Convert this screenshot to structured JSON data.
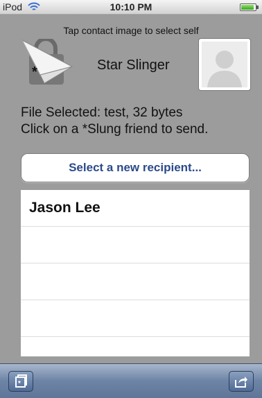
{
  "status_bar": {
    "carrier": "iPod",
    "time": "10:10 PM",
    "icons": [
      "wifi-icon",
      "battery-icon"
    ]
  },
  "header": {
    "hint": "Tap contact image to select self",
    "app_name": "Star Slinger",
    "logo_icon": "star-slinger-logo-icon",
    "self_photo_icon": "contact-placeholder-icon"
  },
  "info": {
    "file_selected": "File Selected: test, 32 bytes",
    "instruction": "Click on a *Slung friend to send."
  },
  "select_button": {
    "label": "Select a new recipient..."
  },
  "recipients": [
    {
      "name": "Jason Lee"
    },
    {
      "name": ""
    },
    {
      "name": ""
    },
    {
      "name": ""
    }
  ],
  "toolbar": {
    "left_icon": "folder-files-icon",
    "right_icon": "share-export-icon"
  },
  "colors": {
    "background": "#9c9c9c",
    "button_text": "#2b4a8a",
    "toolbar": "#6d84a6"
  }
}
